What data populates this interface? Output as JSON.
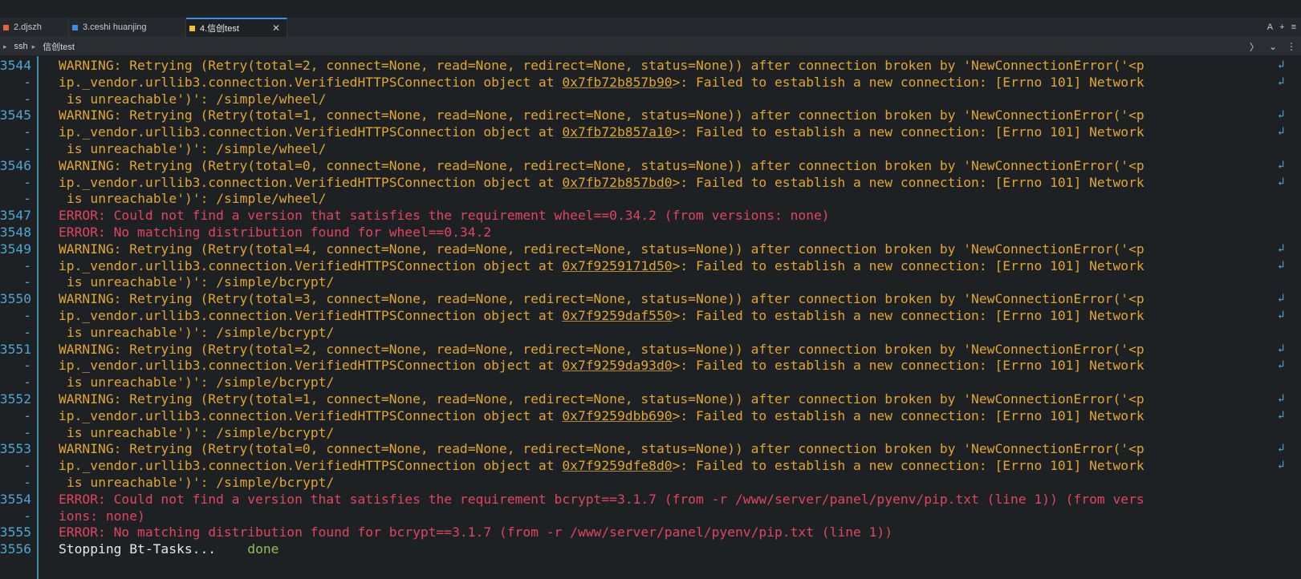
{
  "tabs": [
    {
      "label": "2.djszh",
      "color": "#e8603c",
      "active": false
    },
    {
      "label": "3.ceshi huanjing",
      "color": "#3a8ee6",
      "active": false
    },
    {
      "label": "4.信创test",
      "color": "#f2c230",
      "active": true
    }
  ],
  "tab_actions": {
    "a_label": "A",
    "plus_label": "+",
    "menu_label": "≡"
  },
  "breadcrumb": {
    "items": [
      "ssh",
      "信创test"
    ]
  },
  "terminal": {
    "lines": [
      {
        "num": "3544",
        "segments": [
          {
            "text": "WARNING: Retrying (Retry(total=2, connect=None, read=None, redirect=None, status=None)) after connection broken by 'NewConnectionError('<p",
            "cls": "warn"
          }
        ],
        "wrap": true
      },
      {
        "num": "-",
        "segments": [
          {
            "text": "ip._vendor.urllib3.connection.VerifiedHTTPSConnection object at ",
            "cls": "warn"
          },
          {
            "text": "0x7fb72b857b90",
            "cls": "warn addr"
          },
          {
            "text": ">: Failed to establish a new connection: [Errno 101] Network",
            "cls": "warn"
          }
        ],
        "wrap": true
      },
      {
        "num": "-",
        "segments": [
          {
            "text": "is unreachable')': /simple/wheel/",
            "cls": "warn"
          }
        ],
        "cont": true
      },
      {
        "num": "3545",
        "segments": [
          {
            "text": "WARNING: Retrying (Retry(total=1, connect=None, read=None, redirect=None, status=None)) after connection broken by 'NewConnectionError('<p",
            "cls": "warn"
          }
        ],
        "wrap": true
      },
      {
        "num": "-",
        "segments": [
          {
            "text": "ip._vendor.urllib3.connection.VerifiedHTTPSConnection object at ",
            "cls": "warn"
          },
          {
            "text": "0x7fb72b857a10",
            "cls": "warn addr"
          },
          {
            "text": ">: Failed to establish a new connection: [Errno 101] Network",
            "cls": "warn"
          }
        ],
        "wrap": true
      },
      {
        "num": "-",
        "segments": [
          {
            "text": "is unreachable')': /simple/wheel/",
            "cls": "warn"
          }
        ],
        "cont": true
      },
      {
        "num": "3546",
        "segments": [
          {
            "text": "WARNING: Retrying (Retry(total=0, connect=None, read=None, redirect=None, status=None)) after connection broken by 'NewConnectionError('<p",
            "cls": "warn"
          }
        ],
        "wrap": true
      },
      {
        "num": "-",
        "segments": [
          {
            "text": "ip._vendor.urllib3.connection.VerifiedHTTPSConnection object at ",
            "cls": "warn"
          },
          {
            "text": "0x7fb72b857bd0",
            "cls": "warn addr"
          },
          {
            "text": ">: Failed to establish a new connection: [Errno 101] Network",
            "cls": "warn"
          }
        ],
        "wrap": true
      },
      {
        "num": "-",
        "segments": [
          {
            "text": "is unreachable')': /simple/wheel/",
            "cls": "warn"
          }
        ],
        "cont": true
      },
      {
        "num": "3547",
        "segments": [
          {
            "text": "ERROR: Could not find a version that satisfies the requirement wheel==0.34.2 (from versions: none)",
            "cls": "err"
          }
        ]
      },
      {
        "num": "3548",
        "segments": [
          {
            "text": "ERROR: No matching distribution found for wheel==0.34.2",
            "cls": "err"
          }
        ]
      },
      {
        "num": "3549",
        "segments": [
          {
            "text": "WARNING: Retrying (Retry(total=4, connect=None, read=None, redirect=None, status=None)) after connection broken by 'NewConnectionError('<p",
            "cls": "warn"
          }
        ],
        "wrap": true
      },
      {
        "num": "-",
        "segments": [
          {
            "text": "ip._vendor.urllib3.connection.VerifiedHTTPSConnection object at ",
            "cls": "warn"
          },
          {
            "text": "0x7f9259171d50",
            "cls": "warn addr"
          },
          {
            "text": ">: Failed to establish a new connection: [Errno 101] Network",
            "cls": "warn"
          }
        ],
        "wrap": true
      },
      {
        "num": "-",
        "segments": [
          {
            "text": "is unreachable')': /simple/bcrypt/",
            "cls": "warn"
          }
        ],
        "cont": true
      },
      {
        "num": "3550",
        "segments": [
          {
            "text": "WARNING: Retrying (Retry(total=3, connect=None, read=None, redirect=None, status=None)) after connection broken by 'NewConnectionError('<p",
            "cls": "warn"
          }
        ],
        "wrap": true
      },
      {
        "num": "-",
        "segments": [
          {
            "text": "ip._vendor.urllib3.connection.VerifiedHTTPSConnection object at ",
            "cls": "warn"
          },
          {
            "text": "0x7f9259daf550",
            "cls": "warn addr"
          },
          {
            "text": ">: Failed to establish a new connection: [Errno 101] Network",
            "cls": "warn"
          }
        ],
        "wrap": true
      },
      {
        "num": "-",
        "segments": [
          {
            "text": "is unreachable')': /simple/bcrypt/",
            "cls": "warn"
          }
        ],
        "cont": true
      },
      {
        "num": "3551",
        "segments": [
          {
            "text": "WARNING: Retrying (Retry(total=2, connect=None, read=None, redirect=None, status=None)) after connection broken by 'NewConnectionError('<p",
            "cls": "warn"
          }
        ],
        "wrap": true
      },
      {
        "num": "-",
        "segments": [
          {
            "text": "ip._vendor.urllib3.connection.VerifiedHTTPSConnection object at ",
            "cls": "warn"
          },
          {
            "text": "0x7f9259da93d0",
            "cls": "warn addr"
          },
          {
            "text": ">: Failed to establish a new connection: [Errno 101] Network",
            "cls": "warn"
          }
        ],
        "wrap": true
      },
      {
        "num": "-",
        "segments": [
          {
            "text": "is unreachable')': /simple/bcrypt/",
            "cls": "warn"
          }
        ],
        "cont": true
      },
      {
        "num": "3552",
        "segments": [
          {
            "text": "WARNING: Retrying (Retry(total=1, connect=None, read=None, redirect=None, status=None)) after connection broken by 'NewConnectionError('<p",
            "cls": "warn"
          }
        ],
        "wrap": true
      },
      {
        "num": "-",
        "segments": [
          {
            "text": "ip._vendor.urllib3.connection.VerifiedHTTPSConnection object at ",
            "cls": "warn"
          },
          {
            "text": "0x7f9259dbb690",
            "cls": "warn addr"
          },
          {
            "text": ">: Failed to establish a new connection: [Errno 101] Network",
            "cls": "warn"
          }
        ],
        "wrap": true
      },
      {
        "num": "-",
        "segments": [
          {
            "text": "is unreachable')': /simple/bcrypt/",
            "cls": "warn"
          }
        ],
        "cont": true
      },
      {
        "num": "3553",
        "segments": [
          {
            "text": "WARNING: Retrying (Retry(total=0, connect=None, read=None, redirect=None, status=None)) after connection broken by 'NewConnectionError('<p",
            "cls": "warn"
          }
        ],
        "wrap": true
      },
      {
        "num": "-",
        "segments": [
          {
            "text": "ip._vendor.urllib3.connection.VerifiedHTTPSConnection object at ",
            "cls": "warn"
          },
          {
            "text": "0x7f9259dfe8d0",
            "cls": "warn addr"
          },
          {
            "text": ">: Failed to establish a new connection: [Errno 101] Network",
            "cls": "warn"
          }
        ],
        "wrap": true
      },
      {
        "num": "-",
        "segments": [
          {
            "text": "is unreachable')': /simple/bcrypt/",
            "cls": "warn"
          }
        ],
        "cont": true
      },
      {
        "num": "3554",
        "segments": [
          {
            "text": "ERROR: Could not find a version that satisfies the requirement bcrypt==3.1.7 (from -r /www/server/panel/pyenv/pip.txt (line 1)) (from vers",
            "cls": "err"
          }
        ]
      },
      {
        "num": "-",
        "segments": [
          {
            "text": "ions: none)",
            "cls": "err"
          }
        ]
      },
      {
        "num": "3555",
        "segments": [
          {
            "text": "ERROR: No matching distribution found for bcrypt==3.1.7 (from -r /www/server/panel/pyenv/pip.txt (line 1))",
            "cls": "err"
          }
        ]
      },
      {
        "num": "3556",
        "segments": [
          {
            "text": "Stopping Bt-Tasks...    ",
            "cls": "out"
          },
          {
            "text": "done",
            "cls": "ok"
          }
        ]
      }
    ],
    "wrap_glyph": "↲"
  },
  "colors": {
    "warning": "#e0a630",
    "error": "#e0455f",
    "done": "#8fbf4f",
    "line_number": "#4ea6d6"
  }
}
